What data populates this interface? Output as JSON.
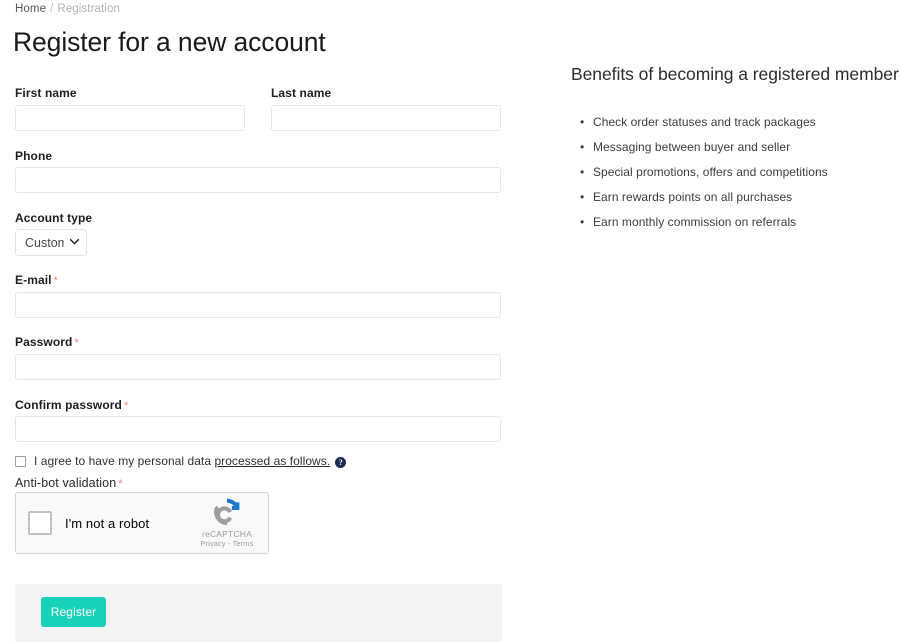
{
  "breadcrumb": {
    "home": "Home",
    "separator": "/",
    "current": "Registration"
  },
  "page": {
    "title": "Register for a new account"
  },
  "form": {
    "first_name": {
      "label": "First name",
      "value": "",
      "placeholder": ""
    },
    "last_name": {
      "label": "Last name",
      "value": "",
      "placeholder": ""
    },
    "phone": {
      "label": "Phone",
      "value": "",
      "placeholder": ""
    },
    "account_type": {
      "label": "Account type",
      "selected": "Customer",
      "options": [
        "Customer"
      ],
      "chevron": "⌄"
    },
    "email": {
      "label": "E-mail",
      "required_marker": "*",
      "value": "",
      "placeholder": ""
    },
    "password": {
      "label": "Password",
      "required_marker": "*",
      "value": "",
      "placeholder": ""
    },
    "confirm_password": {
      "label": "Confirm password",
      "required_marker": "*",
      "value": "",
      "placeholder": ""
    },
    "consent": {
      "text_before": "I agree to have my personal data ",
      "link_text": "processed as follows.",
      "info_icon_glyph": "?",
      "checked": false
    },
    "anti_bot": {
      "label": "Anti-bot validation",
      "required_marker": "*"
    },
    "recaptcha": {
      "checkbox_label": "I'm not a robot",
      "brand": "reCAPTCHA",
      "links": "Privacy - Terms"
    },
    "submit": {
      "label": "Register"
    }
  },
  "benefits": {
    "title": "Benefits of becoming a registered member",
    "items": [
      "Check order statuses and track packages",
      "Messaging between buyer and seller",
      "Special promotions, offers and competitions",
      "Earn rewards points on all purchases",
      "Earn monthly commission on referrals"
    ]
  },
  "colors": {
    "accent": "#17d2b8",
    "required": "#f08a7a",
    "info_icon": "#1b2a52",
    "footer_bg": "#f4f4f4"
  }
}
